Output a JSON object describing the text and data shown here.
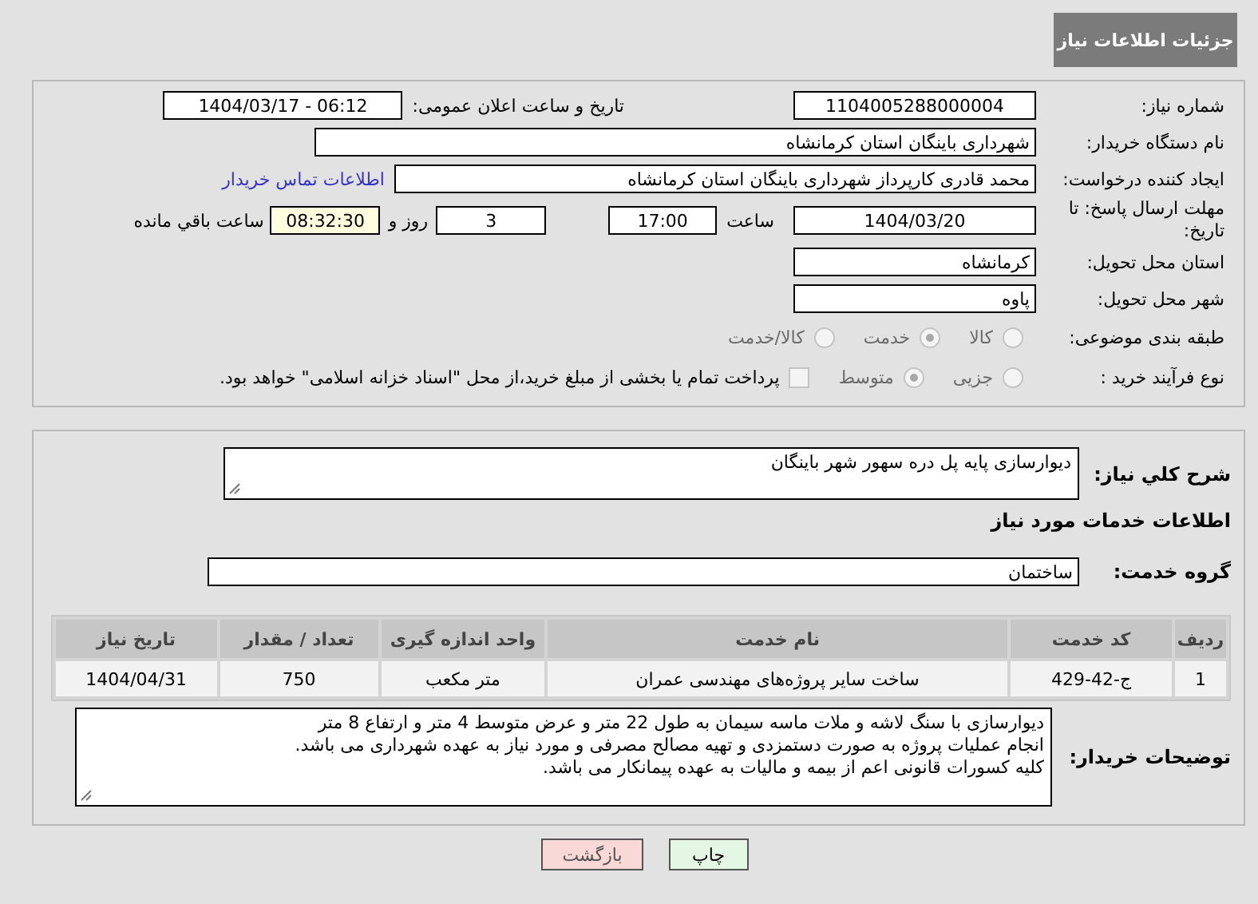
{
  "header": {
    "title": "جزئیات اطلاعات نیاز"
  },
  "need_number": {
    "label": "شماره نیاز:",
    "value": "1104005288000004"
  },
  "announce_datetime": {
    "label": "تاریخ و ساعت اعلان عمومی:",
    "value": "1404/03/17 - 06:12"
  },
  "buyer_org": {
    "label": "نام دستگاه خریدار:",
    "value": "شهرداری باینگان استان کرمانشاه"
  },
  "requester": {
    "label": "ایجاد کننده درخواست:",
    "value": "محمد قادری کارپرداز شهرداری باینگان استان کرمانشاه",
    "link": "اطلاعات تماس خریدار"
  },
  "deadline": {
    "label": "مهلت ارسال پاسخ: تا تاریخ:",
    "date": "1404/03/20",
    "time_label": "ساعت",
    "time": "17:00",
    "days": "3",
    "days_label": "روز و",
    "remaining": "08:32:30",
    "remaining_label": "ساعت باقي مانده"
  },
  "delivery_province": {
    "label": "استان محل تحویل:",
    "value": "کرمانشاه"
  },
  "delivery_city": {
    "label": "شهر محل تحویل:",
    "value": "پاوه"
  },
  "category": {
    "label": "طبقه بندی موضوعی:",
    "options": [
      {
        "label": "کالا",
        "selected": false
      },
      {
        "label": "خدمت",
        "selected": true
      },
      {
        "label": "کالا/خدمت",
        "selected": false
      }
    ]
  },
  "process": {
    "label": "نوع فرآیند خرید :",
    "options": [
      {
        "label": "جزیی",
        "selected": false
      },
      {
        "label": "متوسط",
        "selected": true
      }
    ],
    "treasury": {
      "label": "پرداخت تمام یا بخشی از مبلغ خرید،از محل \"اسناد خزانه اسلامی\" خواهد بود.",
      "checked": false
    }
  },
  "description": {
    "label": "شرح کلي نیاز:",
    "value": "دیوارسازی پایه پل دره سهور شهر باینگان"
  },
  "services_heading": "اطلاعات خدمات مورد نیاز",
  "service_group": {
    "label": "گروه خدمت:",
    "value": "ساختمان"
  },
  "table": {
    "columns": [
      "ردیف",
      "کد خدمت",
      "نام خدمت",
      "واحد اندازه گیری",
      "تعداد / مقدار",
      "تاریخ نیاز"
    ],
    "rows": [
      [
        "1",
        "ج-42-429",
        "ساخت سایر پروژه‌های مهندسی عمران",
        "متر مکعب",
        "750",
        "1404/04/31"
      ]
    ]
  },
  "buyer_notes": {
    "label": "توضیحات خریدار:",
    "lines": [
      "دیوارسازی با سنگ لاشه و ملات ماسه سیمان به طول 22 متر و عرض متوسط 4 متر و ارتفاع 8 متر",
      "انجام عملیات پروژه به صورت دستمزدی و تهیه مصالح مصرفی و مورد نیاز به عهده شهرداری می باشد.",
      "کلیه کسورات قانونی اعم از بیمه و مالیات به عهده پیمانکار می باشد."
    ]
  },
  "buttons": [
    {
      "label": "چاپ",
      "kind": "print"
    },
    {
      "label": "بازگشت",
      "kind": "back"
    }
  ]
}
